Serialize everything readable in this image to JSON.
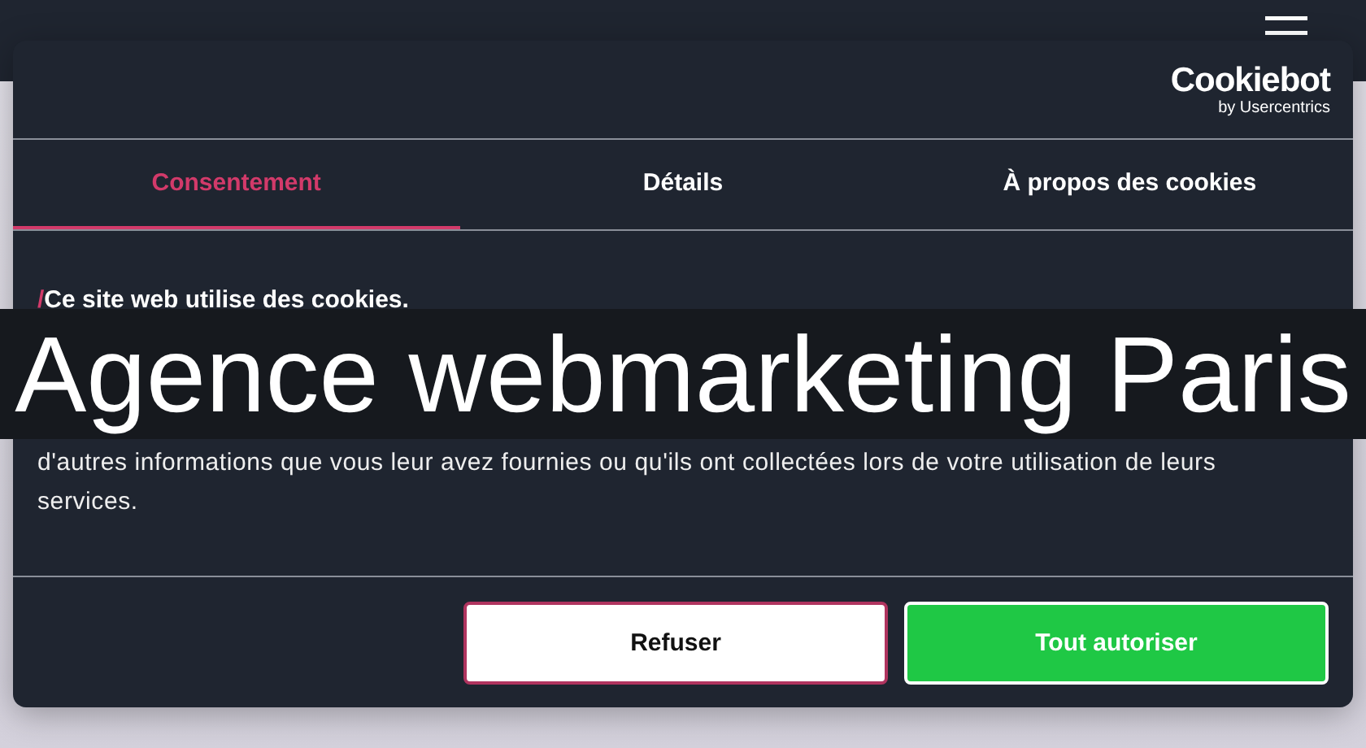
{
  "dialog": {
    "brand": {
      "name": "Cookiebot",
      "byline": "by Usercentrics"
    },
    "tabs": [
      {
        "label": "Consentement",
        "selected": true
      },
      {
        "label": "Détails",
        "selected": false
      },
      {
        "label": "À propos des cookies",
        "selected": false
      }
    ],
    "heading_mark": "/",
    "heading": "Ce site web utilise des cookies.",
    "body": "d'autres informations que vous leur avez fournies ou qu'ils ont collectées lors de votre utilisation de leurs services.",
    "buttons": [
      {
        "label": "Refuser",
        "kind": "secondary"
      },
      {
        "label": "Tout autoriser",
        "kind": "primary"
      }
    ]
  },
  "overlay_title": "Agence webmarketing Paris"
}
